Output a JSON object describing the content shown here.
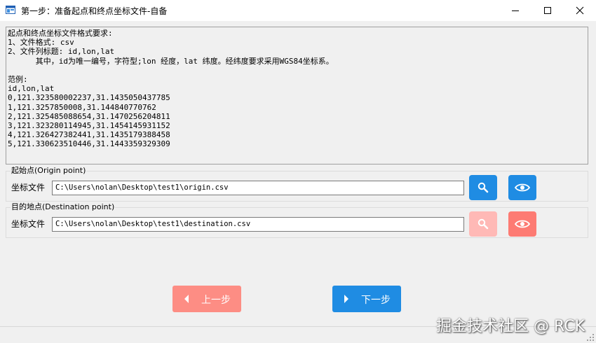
{
  "window": {
    "title": "第一步：准备起点和终点坐标文件-自备",
    "minimize_glyph": "minimize-icon",
    "maximize_glyph": "maximize-icon",
    "close_glyph": "close-icon"
  },
  "info": {
    "lines": [
      "起点和终点坐标文件格式要求:",
      "1、文件格式: csv",
      "2、文件列标题: id,lon,lat",
      "      其中，id为唯一编号，字符型;lon 经度，lat 纬度。经纬度要求采用WGS84坐标系。",
      "",
      "范例:",
      "id,lon,lat",
      "0,121.323580002237,31.1435050437785",
      "1,121.3257850008,31.144840770762",
      "2,121.325485088654,31.1470256204811",
      "3,121.323280114945,31.1454145931152",
      "4,121.326427382441,31.1435179388458",
      "5,121.330623510446,31.1443359329309"
    ]
  },
  "origin": {
    "legend": "起始点(Origin point)",
    "field_label": "坐标文件",
    "path": "C:\\Users\\nolan\\Desktop\\test1\\origin.csv",
    "search_icon": "search-icon",
    "view_icon": "eye-icon"
  },
  "destination": {
    "legend": "目的地点(Destination point)",
    "field_label": "坐标文件",
    "path": "C:\\Users\\nolan\\Desktop\\test1\\destination.csv",
    "search_icon": "search-icon",
    "view_icon": "eye-icon"
  },
  "navigation": {
    "prev_label": "上一步",
    "next_label": "下一步"
  },
  "watermark": "掘金技术社区 @ RCK",
  "colors": {
    "primary_blue": "#1f8ce3",
    "danger_red": "#fd7b73",
    "danger_red_disabled": "#ffb9b6",
    "prev_button": "#fd8d84"
  }
}
